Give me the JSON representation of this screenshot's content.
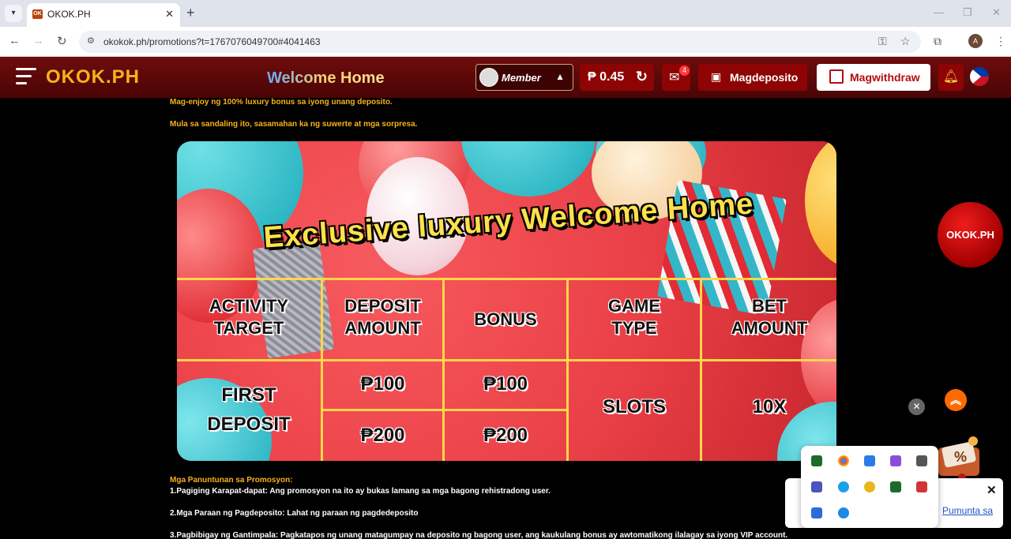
{
  "browser": {
    "tab_title": "OKOK.PH",
    "tab_favicon": "OK",
    "url": "okokok.ph/promotions?t=1767076049700#4041463",
    "avatar_initial": "A"
  },
  "header": {
    "logo": "OKOK.PH",
    "page_title": "Welcome Home",
    "member_label": "Member",
    "balance": "₱ 0.45",
    "mail_count": "4",
    "deposit_label": "Magdeposito",
    "withdraw_label": "Magwithdraw"
  },
  "intro": {
    "line1": "Mag-enjoy ng 100% luxury bonus sa iyong unang deposito.",
    "line2": "Mula sa sandaling ito, sasamahan ka ng suwerte at mga sorpresa."
  },
  "banner": {
    "title": "Exclusive luxury Welcome Home",
    "headers": [
      "ACTIVITY\nTARGET",
      "DEPOSIT\nAMOUNT",
      "BONUS",
      "GAME\nTYPE",
      "BET\nAMOUNT"
    ],
    "target": "FIRST\nDEPOSIT",
    "deposit_1": "₱100",
    "bonus_1": "₱100",
    "deposit_2": "₱200",
    "bonus_2": "₱200",
    "game_type": "SLOTS",
    "bet_amount": "10X"
  },
  "rules": {
    "heading": "Mga Panuntunan sa Promosyon:",
    "rule1": "1.Pagiging Karapat-dapat: Ang promosyon na ito ay bukas lamang sa mga bagong rehistradong user.",
    "rule2": "2.Mga Paraan ng Pagdeposito: Lahat ng paraan ng pagdedeposito",
    "rule3": "3.Pagbibigay ng Gantimpala: Pagkatapos ng unang matagumpay na deposito ng bagong user, ang kaukulang bonus ay awtomatikong ilalagay sa iyong VIP account."
  },
  "side": {
    "logo": "OKOK.PH"
  },
  "notification": {
    "link": "Pumunta sa"
  }
}
